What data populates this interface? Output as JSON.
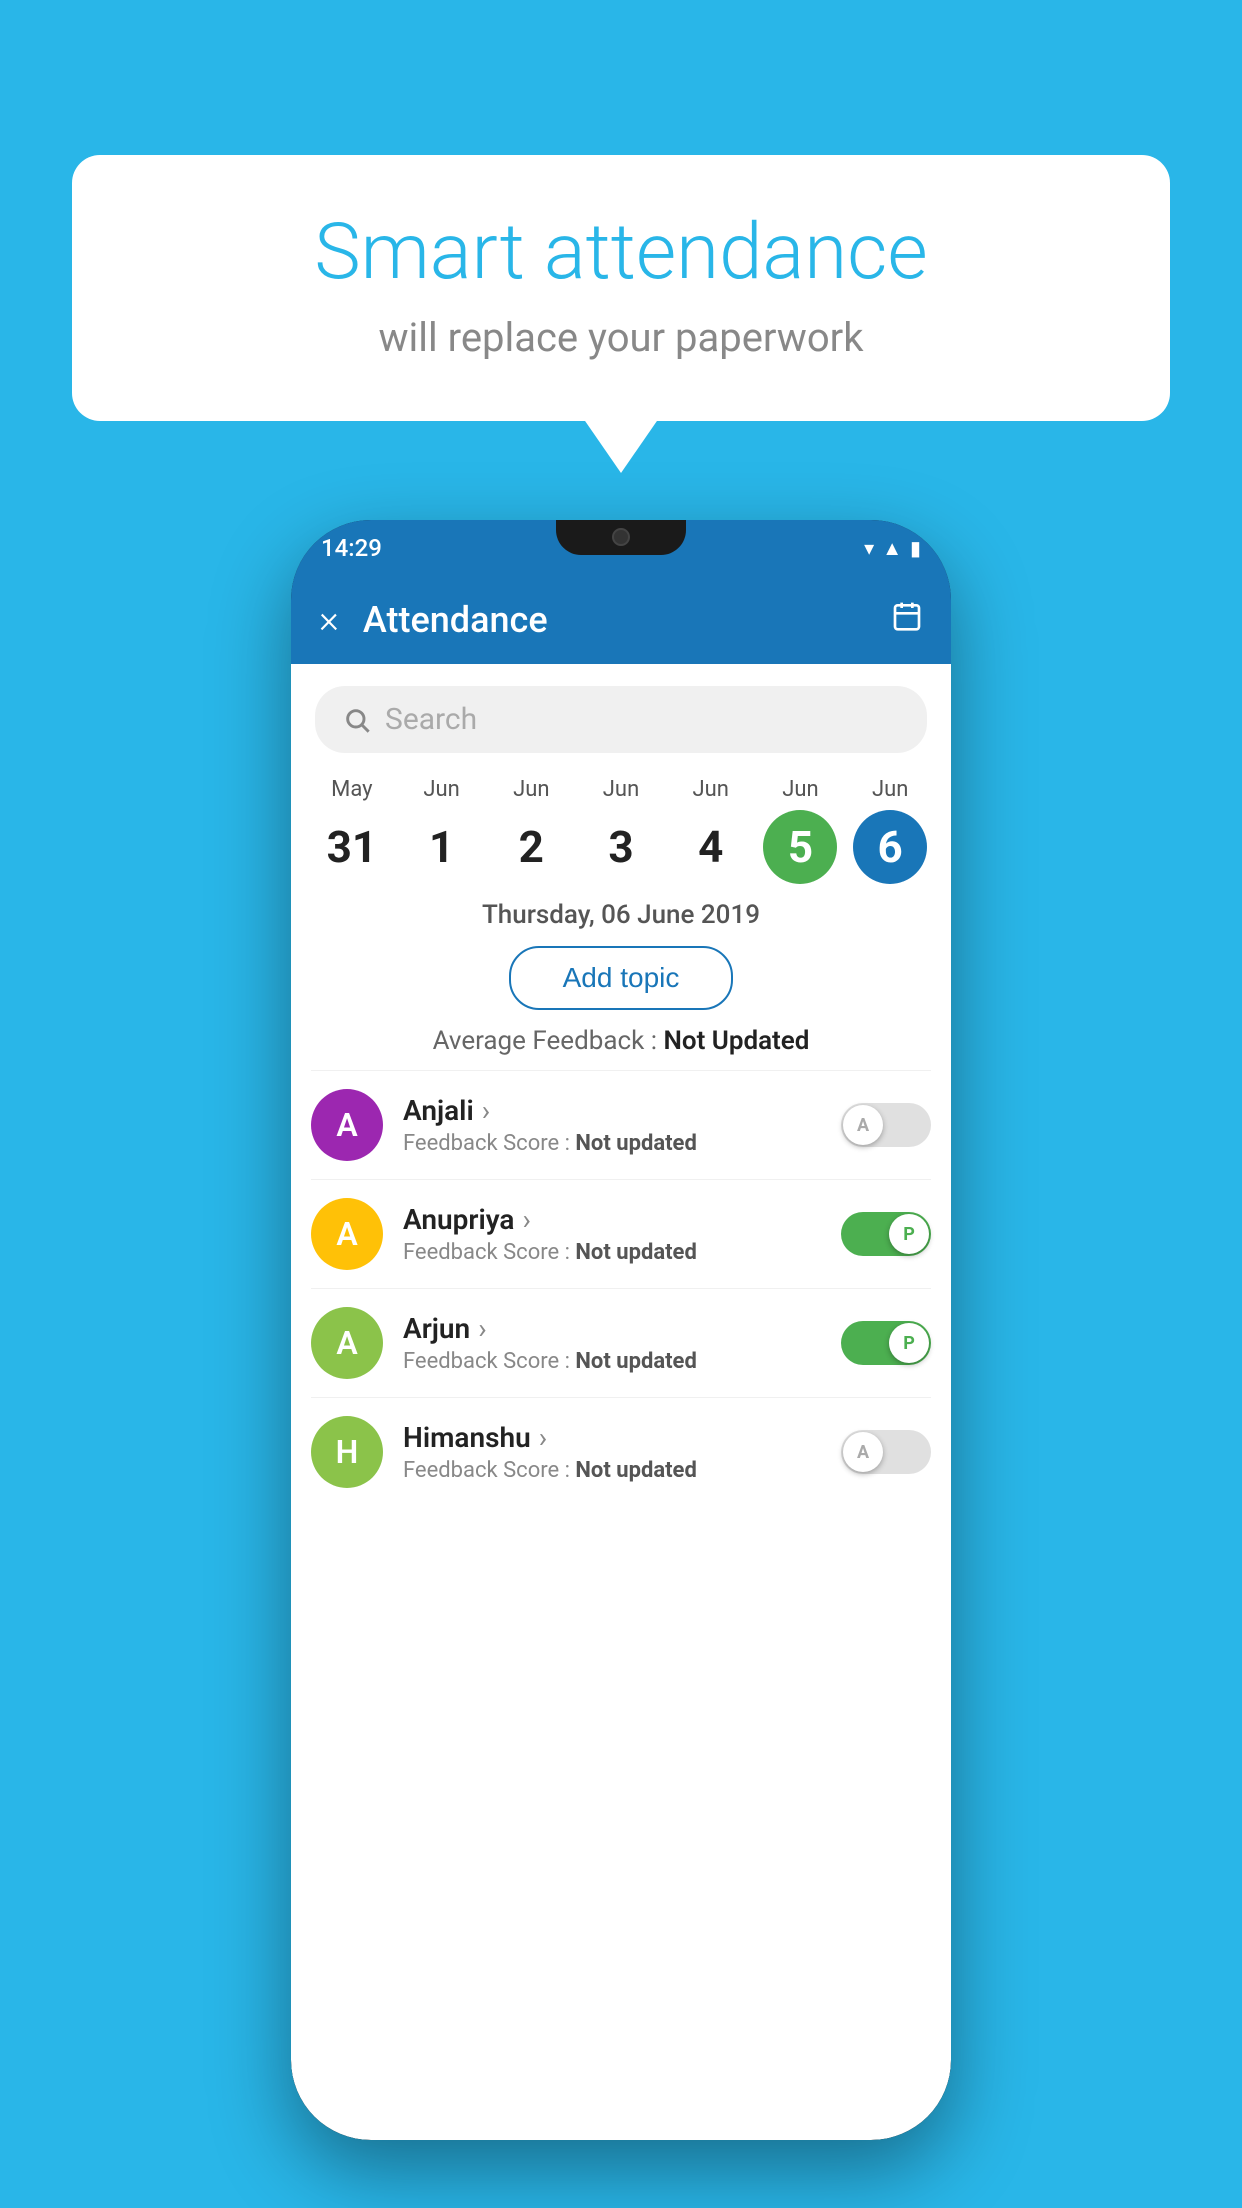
{
  "background_color": "#29B6E8",
  "speech_bubble": {
    "title": "Smart attendance",
    "subtitle": "will replace your paperwork"
  },
  "status_bar": {
    "time": "14:29",
    "icons": [
      "wifi",
      "signal",
      "battery"
    ]
  },
  "app_bar": {
    "title": "Attendance",
    "close_label": "×",
    "calendar_icon": "calendar-icon"
  },
  "search": {
    "placeholder": "Search"
  },
  "calendar": {
    "days": [
      {
        "month": "May",
        "date": "31",
        "state": "normal"
      },
      {
        "month": "Jun",
        "date": "1",
        "state": "normal"
      },
      {
        "month": "Jun",
        "date": "2",
        "state": "normal"
      },
      {
        "month": "Jun",
        "date": "3",
        "state": "normal"
      },
      {
        "month": "Jun",
        "date": "4",
        "state": "normal"
      },
      {
        "month": "Jun",
        "date": "5",
        "state": "today"
      },
      {
        "month": "Jun",
        "date": "6",
        "state": "selected"
      }
    ],
    "selected_date": "Thursday, 06 June 2019"
  },
  "add_topic_label": "Add topic",
  "avg_feedback": {
    "label": "Average Feedback : ",
    "value": "Not Updated"
  },
  "students": [
    {
      "name": "Anjali",
      "avatar_letter": "A",
      "avatar_color": "#9C27B0",
      "feedback": "Feedback Score : ",
      "feedback_value": "Not updated",
      "toggle_state": "off",
      "toggle_label": "A"
    },
    {
      "name": "Anupriya",
      "avatar_letter": "A",
      "avatar_color": "#FFC107",
      "feedback": "Feedback Score : ",
      "feedback_value": "Not updated",
      "toggle_state": "on",
      "toggle_label": "P"
    },
    {
      "name": "Arjun",
      "avatar_letter": "A",
      "avatar_color": "#8BC34A",
      "feedback": "Feedback Score : ",
      "feedback_value": "Not updated",
      "toggle_state": "on",
      "toggle_label": "P"
    },
    {
      "name": "Himanshu",
      "avatar_letter": "H",
      "avatar_color": "#8BC34A",
      "feedback": "Feedback Score : ",
      "feedback_value": "Not updated",
      "toggle_state": "off",
      "toggle_label": "A"
    }
  ]
}
